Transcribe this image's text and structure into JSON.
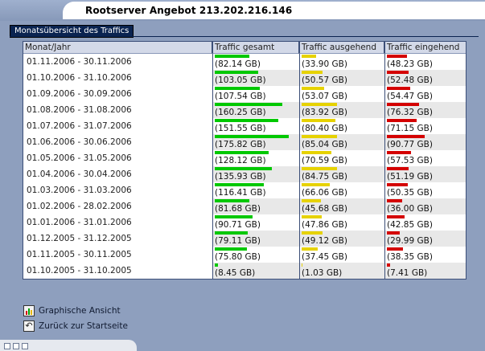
{
  "window": {
    "title": "Rootserver Angebot 213.202.216.146"
  },
  "panel": {
    "tab_label": "Monatsübersicht des Traffics"
  },
  "table": {
    "headers": {
      "month": "Monat/Jahr",
      "total": "Traffic gesamt",
      "outgoing": "Traffic ausgehend",
      "incoming": "Traffic eingehend"
    },
    "rows": [
      {
        "month": "01.11.2006 - 30.11.2006",
        "total": "(82.14 GB)",
        "outgoing": "(33.90 GB)",
        "incoming": "(48.23 GB)",
        "total_gb": 82.14,
        "outgoing_gb": 33.9,
        "incoming_gb": 48.23
      },
      {
        "month": "01.10.2006 - 31.10.2006",
        "total": "(103.05 GB)",
        "outgoing": "(50.57 GB)",
        "incoming": "(52.48 GB)",
        "total_gb": 103.05,
        "outgoing_gb": 50.57,
        "incoming_gb": 52.48
      },
      {
        "month": "01.09.2006 - 30.09.2006",
        "total": "(107.54 GB)",
        "outgoing": "(53.07 GB)",
        "incoming": "(54.47 GB)",
        "total_gb": 107.54,
        "outgoing_gb": 53.07,
        "incoming_gb": 54.47
      },
      {
        "month": "01.08.2006 - 31.08.2006",
        "total": "(160.25 GB)",
        "outgoing": "(83.92 GB)",
        "incoming": "(76.32 GB)",
        "total_gb": 160.25,
        "outgoing_gb": 83.92,
        "incoming_gb": 76.32
      },
      {
        "month": "01.07.2006 - 31.07.2006",
        "total": "(151.55 GB)",
        "outgoing": "(80.40 GB)",
        "incoming": "(71.15 GB)",
        "total_gb": 151.55,
        "outgoing_gb": 80.4,
        "incoming_gb": 71.15
      },
      {
        "month": "01.06.2006 - 30.06.2006",
        "total": "(175.82 GB)",
        "outgoing": "(85.04 GB)",
        "incoming": "(90.77 GB)",
        "total_gb": 175.82,
        "outgoing_gb": 85.04,
        "incoming_gb": 90.77
      },
      {
        "month": "01.05.2006 - 31.05.2006",
        "total": "(128.12 GB)",
        "outgoing": "(70.59 GB)",
        "incoming": "(57.53 GB)",
        "total_gb": 128.12,
        "outgoing_gb": 70.59,
        "incoming_gb": 57.53
      },
      {
        "month": "01.04.2006 - 30.04.2006",
        "total": "(135.93 GB)",
        "outgoing": "(84.75 GB)",
        "incoming": "(51.19 GB)",
        "total_gb": 135.93,
        "outgoing_gb": 84.75,
        "incoming_gb": 51.19
      },
      {
        "month": "01.03.2006 - 31.03.2006",
        "total": "(116.41 GB)",
        "outgoing": "(66.06 GB)",
        "incoming": "(50.35 GB)",
        "total_gb": 116.41,
        "outgoing_gb": 66.06,
        "incoming_gb": 50.35
      },
      {
        "month": "01.02.2006 - 28.02.2006",
        "total": "(81.68 GB)",
        "outgoing": "(45.68 GB)",
        "incoming": "(36.00 GB)",
        "total_gb": 81.68,
        "outgoing_gb": 45.68,
        "incoming_gb": 36.0
      },
      {
        "month": "01.01.2006 - 31.01.2006",
        "total": "(90.71 GB)",
        "outgoing": "(47.86 GB)",
        "incoming": "(42.85 GB)",
        "total_gb": 90.71,
        "outgoing_gb": 47.86,
        "incoming_gb": 42.85
      },
      {
        "month": "01.12.2005 - 31.12.2005",
        "total": "(79.11 GB)",
        "outgoing": "(49.12 GB)",
        "incoming": "(29.99 GB)",
        "total_gb": 79.11,
        "outgoing_gb": 49.12,
        "incoming_gb": 29.99
      },
      {
        "month": "01.11.2005 - 30.11.2005",
        "total": "(75.80 GB)",
        "outgoing": "(37.45 GB)",
        "incoming": "(38.35 GB)",
        "total_gb": 75.8,
        "outgoing_gb": 37.45,
        "incoming_gb": 38.35
      },
      {
        "month": "01.10.2005 - 31.10.2005",
        "total": "(8.45 GB)",
        "outgoing": "(1.03 GB)",
        "incoming": "(7.41 GB)",
        "total_gb": 8.45,
        "outgoing_gb": 1.03,
        "incoming_gb": 7.41
      }
    ],
    "bar_colors": {
      "total": "#00c800",
      "outgoing": "#e6d200",
      "incoming": "#d40000"
    }
  },
  "links": {
    "graphic": {
      "label": "Graphische Ansicht",
      "icon": "chart-icon"
    },
    "back": {
      "label": "Zurück zur Startseite",
      "icon": "back-arrow-icon"
    }
  }
}
